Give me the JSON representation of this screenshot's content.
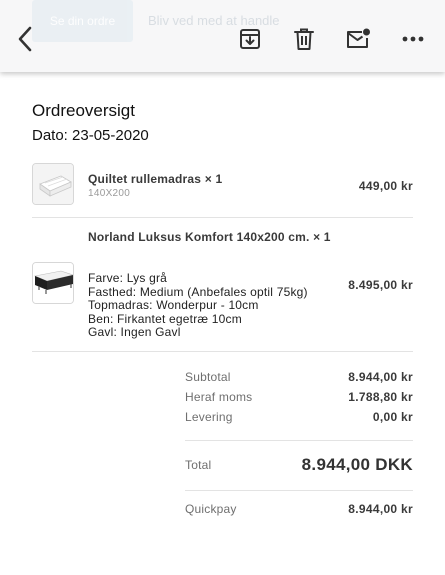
{
  "toolbar": {
    "ghost_button_label": "Se din ordre",
    "ghost_link_label": "Bliv ved med at handle",
    "icons": [
      "chevron-left-icon",
      "archive-icon",
      "trash-icon",
      "mail-unread-icon",
      "more-horizontal-icon"
    ]
  },
  "order": {
    "title": "Ordreoversigt",
    "date": "Dato: 23-05-2020",
    "items": [
      {
        "name": "Quiltet rullemadras × 1",
        "variant": "140X200",
        "price": "449,00 kr"
      },
      {
        "name": "Norland Luksus Komfort 140x200 cm. × 1",
        "options": [
          "Farve: Lys grå",
          "Fasthed: Medium (Anbefales optil 75kg)",
          "Topmadras: Wonderpur - 10cm",
          "Ben: Firkantet egetræ 10cm",
          "Gavl: Ingen Gavl"
        ],
        "price": "8.495,00 kr"
      }
    ],
    "summary": {
      "subtotal_label": "Subtotal",
      "subtotal_value": "8.944,00 kr",
      "vat_label": "Heraf moms",
      "vat_value": "1.788,80 kr",
      "shipping_label": "Levering",
      "shipping_value": "0,00 kr",
      "total_label": "Total",
      "total_value": "8.944,00 DKK",
      "payment_label": "Quickpay",
      "payment_value": "8.944,00 kr"
    }
  },
  "colors": {
    "toolbar_bg": "#f7f7f8",
    "icon": "#333333",
    "divider": "#e3e3e3"
  }
}
